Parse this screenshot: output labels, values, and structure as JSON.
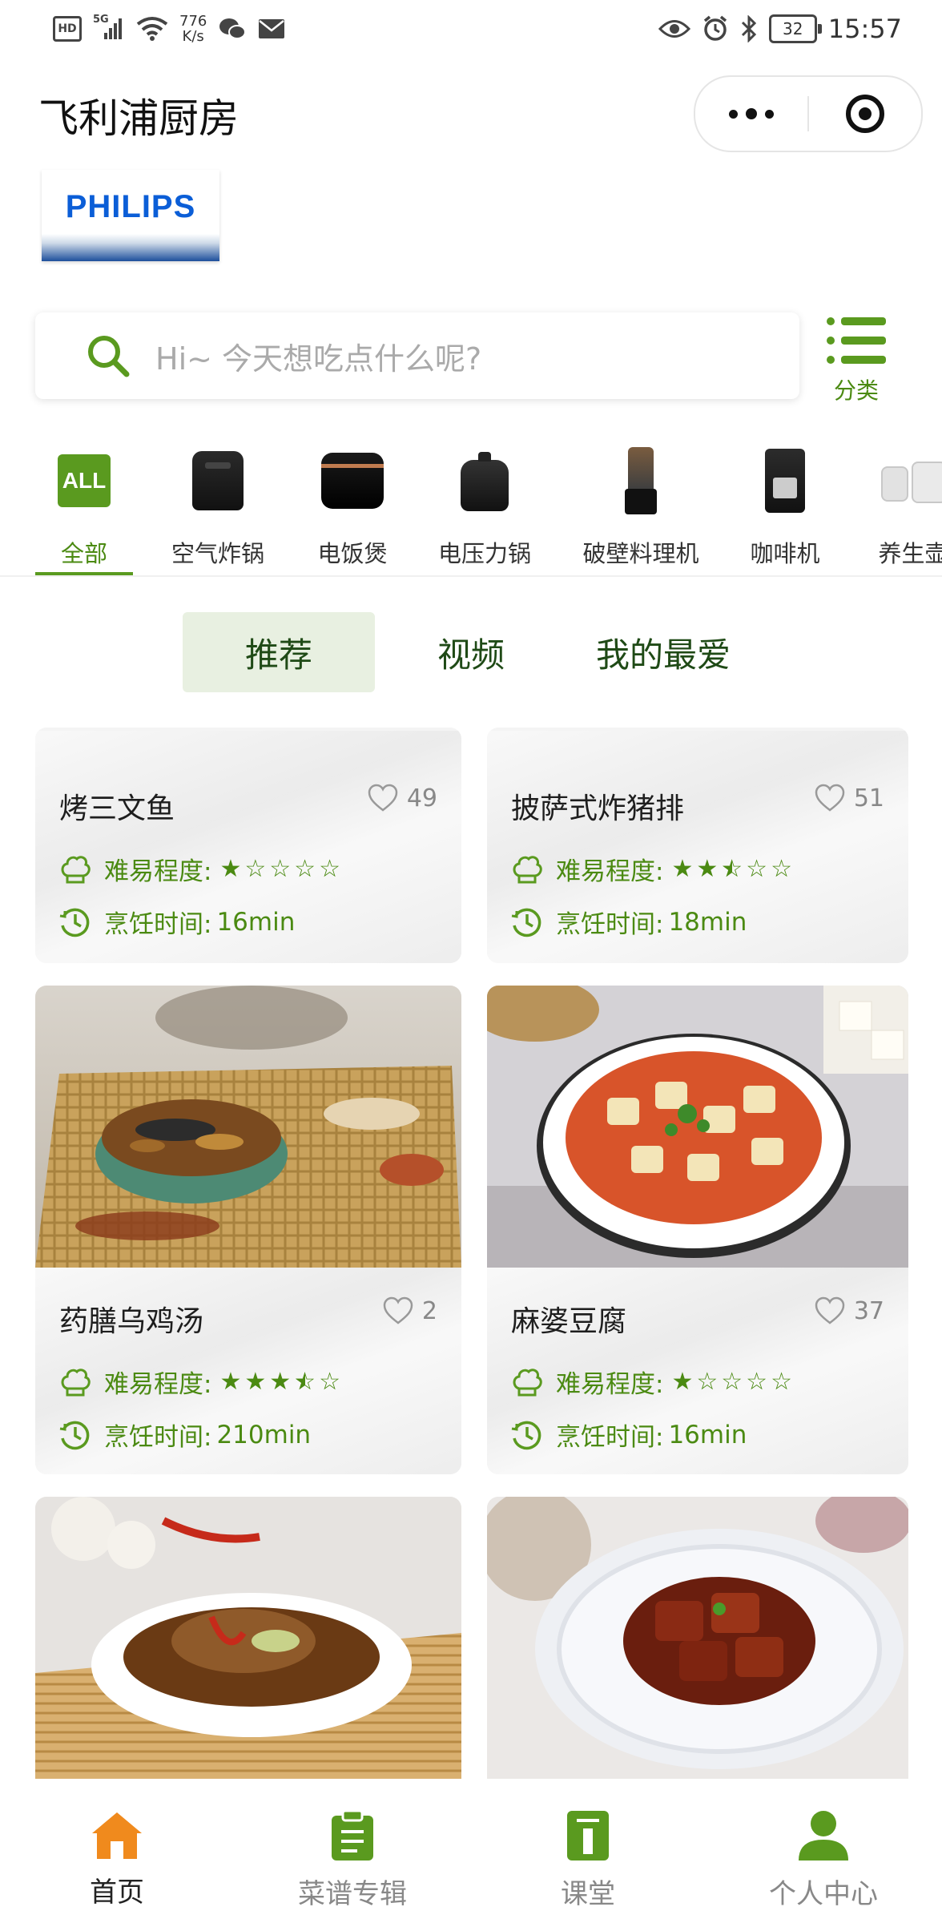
{
  "status_bar": {
    "network_left": "HD",
    "signal": "5G",
    "speed_value": "776",
    "speed_unit": "K/s",
    "battery": "32",
    "time": "15:57"
  },
  "header": {
    "title": "飞利浦厨房"
  },
  "logo": {
    "text": "PHILIPS"
  },
  "search": {
    "placeholder": "Hi~ 今天想吃点什么呢?",
    "category_label": "分类"
  },
  "categories": [
    {
      "label": "全部",
      "badge": "ALL",
      "active": true,
      "icon": "all-icon"
    },
    {
      "label": "空气炸锅",
      "icon": "air-fryer-icon"
    },
    {
      "label": "电饭煲",
      "icon": "rice-cooker-icon"
    },
    {
      "label": "电压力锅",
      "icon": "pressure-cooker-icon"
    },
    {
      "label": "破壁料理机",
      "icon": "blender-icon"
    },
    {
      "label": "咖啡机",
      "icon": "coffee-machine-icon"
    },
    {
      "label": "养生壶",
      "icon": "kettle-icon"
    }
  ],
  "content_tabs": [
    "推荐",
    "视频",
    "我的最爱"
  ],
  "difficulty_label": "难易程度:",
  "time_label": "烹饪时间:",
  "recipes": [
    {
      "title": "烤三文鱼",
      "likes": "49",
      "difficulty": 1,
      "time": "16min"
    },
    {
      "title": "披萨式炸猪排",
      "likes": "51",
      "difficulty": 2.5,
      "time": "18min"
    },
    {
      "title": "药膳乌鸡汤",
      "likes": "2",
      "difficulty": 3.5,
      "time": "210min"
    },
    {
      "title": "麻婆豆腐",
      "likes": "37",
      "difficulty": 1,
      "time": "16min"
    }
  ],
  "bottom_nav": [
    {
      "label": "首页",
      "icon": "home-icon",
      "active": true
    },
    {
      "label": "菜谱专辑",
      "icon": "clipboard-icon"
    },
    {
      "label": "课堂",
      "icon": "classroom-icon"
    },
    {
      "label": "个人中心",
      "icon": "user-icon"
    }
  ],
  "colors": {
    "accent": "#5a9a1f",
    "accent_text": "#4b8a12",
    "tab_active_bg": "#e8f0e1",
    "home_orange": "#f08a1d"
  }
}
